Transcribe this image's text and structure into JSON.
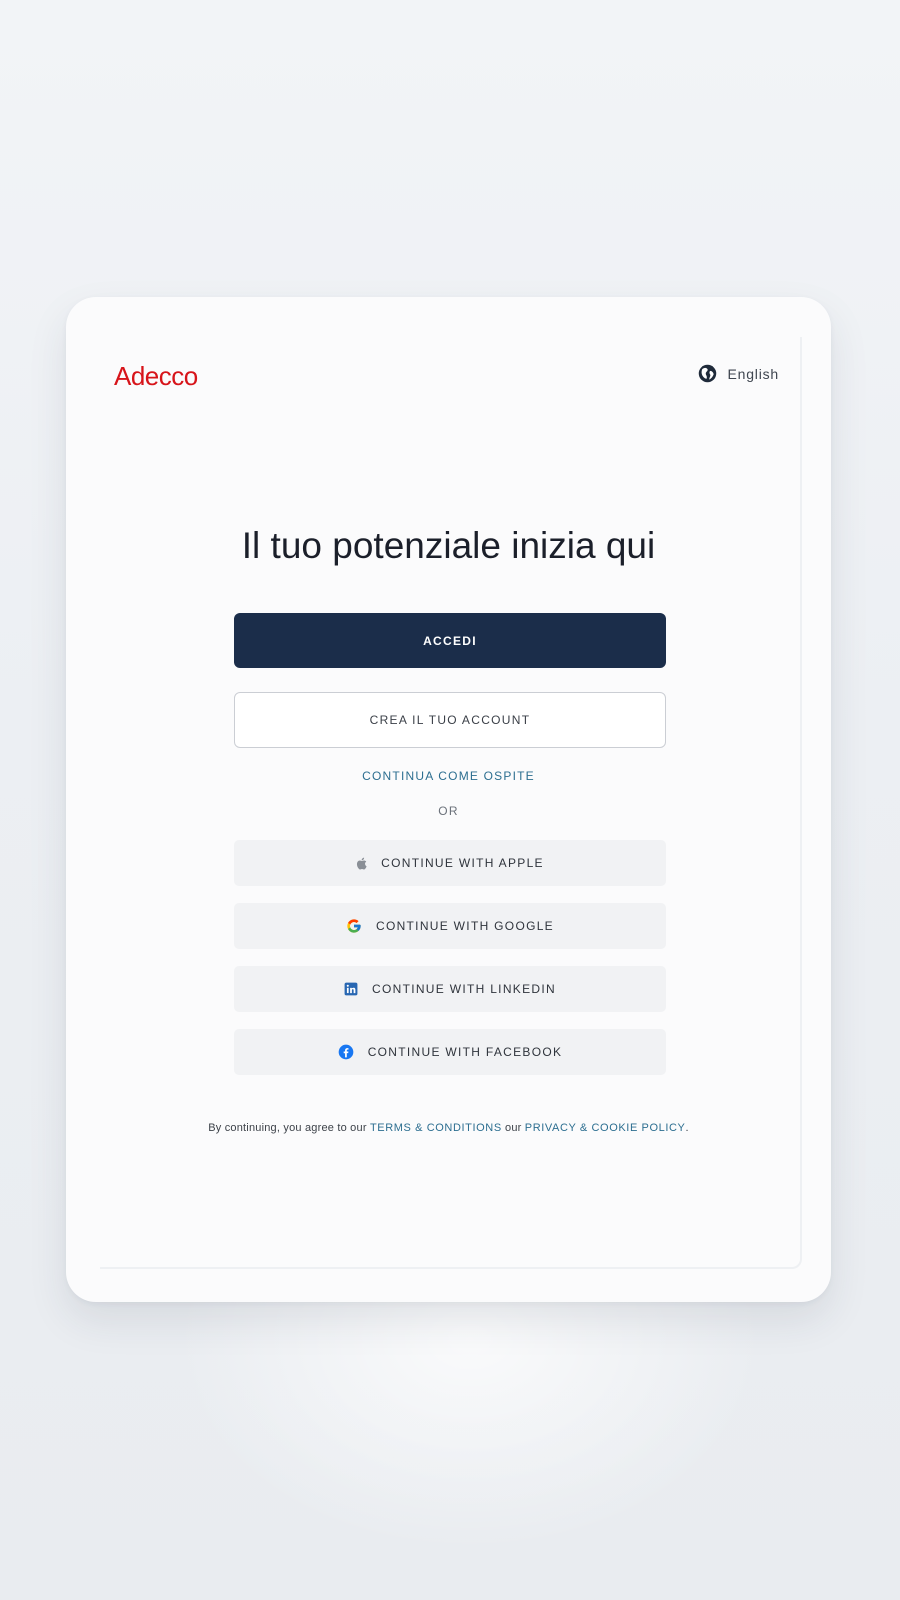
{
  "brand": {
    "logo_text": "Adecco",
    "logo_color": "#d7141a"
  },
  "language": {
    "icon": "globe-icon",
    "label": "English"
  },
  "headline": "Il tuo potenziale inizia qui",
  "buttons": {
    "login": "ACCEDI",
    "create_account": "CREA IL TUO ACCOUNT",
    "guest": "CONTINUA COME OSPITE"
  },
  "divider_text": "OR",
  "social": [
    {
      "icon": "apple-icon",
      "label": "CONTINUE WITH APPLE"
    },
    {
      "icon": "google-icon",
      "label": "CONTINUE WITH GOOGLE"
    },
    {
      "icon": "linkedin-icon",
      "label": "CONTINUE WITH LINKEDIN"
    },
    {
      "icon": "facebook-icon",
      "label": "CONTINUE WITH FACEBOOK"
    }
  ],
  "legal": {
    "prefix": "By continuing, you agree to our ",
    "terms_link": "TERMS & CONDITIONS",
    "middle": " our ",
    "privacy_link": "PRIVACY & COOKIE POLICY",
    "suffix": "."
  },
  "colors": {
    "primary_button": "#1b2d4a",
    "link": "#2c6e90",
    "social_button_bg": "#f1f2f4"
  }
}
